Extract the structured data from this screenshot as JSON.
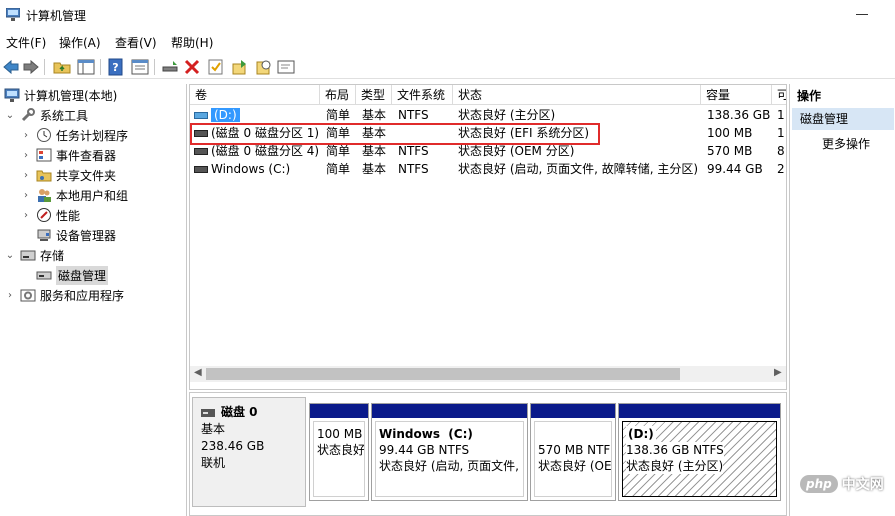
{
  "window": {
    "title": "计算机管理"
  },
  "menu": [
    "文件(F)",
    "操作(A)",
    "查看(V)",
    "帮助(H)"
  ],
  "toolbar_icons": [
    "back-arrow-icon",
    "forward-arrow-icon",
    "up-folder-icon",
    "show-hide-tree-icon",
    "help-icon",
    "properties-icon",
    "connect-icon",
    "delete-icon",
    "check-icon",
    "export-icon",
    "search-icon",
    "console-icon"
  ],
  "tree": {
    "root": "计算机管理(本地)",
    "system_tools": "系统工具",
    "task_scheduler": "任务计划程序",
    "event_viewer": "事件查看器",
    "shared_folders": "共享文件夹",
    "local_users": "本地用户和组",
    "performance": "性能",
    "device_manager": "设备管理器",
    "storage": "存储",
    "disk_management": "磁盘管理",
    "services": "服务和应用程序"
  },
  "columns": [
    "卷",
    "布局",
    "类型",
    "文件系统",
    "状态",
    "容量",
    "可"
  ],
  "volumes": [
    {
      "name": "(D:)",
      "layout": "简单",
      "type": "基本",
      "fs": "NTFS",
      "status": "状态良好 (主分区)",
      "capacity": "138.36 GB",
      "free": "1"
    },
    {
      "name": "(磁盘 0 磁盘分区 1)",
      "layout": "简单",
      "type": "基本",
      "fs": "",
      "status": "状态良好 (EFI 系统分区)",
      "capacity": "100 MB",
      "free": "1"
    },
    {
      "name": "(磁盘 0 磁盘分区 4)",
      "layout": "简单",
      "type": "基本",
      "fs": "NTFS",
      "status": "状态良好 (OEM 分区)",
      "capacity": "570 MB",
      "free": "8"
    },
    {
      "name": "Windows (C:)",
      "layout": "简单",
      "type": "基本",
      "fs": "NTFS",
      "status": "状态良好 (启动, 页面文件, 故障转储, 主分区)",
      "capacity": "99.44 GB",
      "free": "2"
    }
  ],
  "disk": {
    "name": "磁盘 0",
    "type": "基本",
    "size": "238.46 GB",
    "state": "联机"
  },
  "partitions": [
    {
      "name": "",
      "size": "100 MB",
      "status": "状态良好"
    },
    {
      "name": "Windows  (C:)",
      "size": "99.44 GB NTFS",
      "status": "状态良好 (启动, 页面文件, 故"
    },
    {
      "name": "",
      "size": "570 MB NTF",
      "status": "状态良好 (OE"
    },
    {
      "name": "(D:)",
      "size": "138.36 GB NTFS",
      "status": "状态良好 (主分区)"
    }
  ],
  "actions": {
    "header": "操作",
    "selected": "磁盘管理",
    "more": "更多操作"
  },
  "watermark": {
    "logo": "php",
    "site": "中文网"
  },
  "colors": {
    "partition_bar": "#0a1a8a",
    "highlight_box": "#e02b2b",
    "selection": "#3399ff",
    "action_selected": "#d7e6f5"
  }
}
